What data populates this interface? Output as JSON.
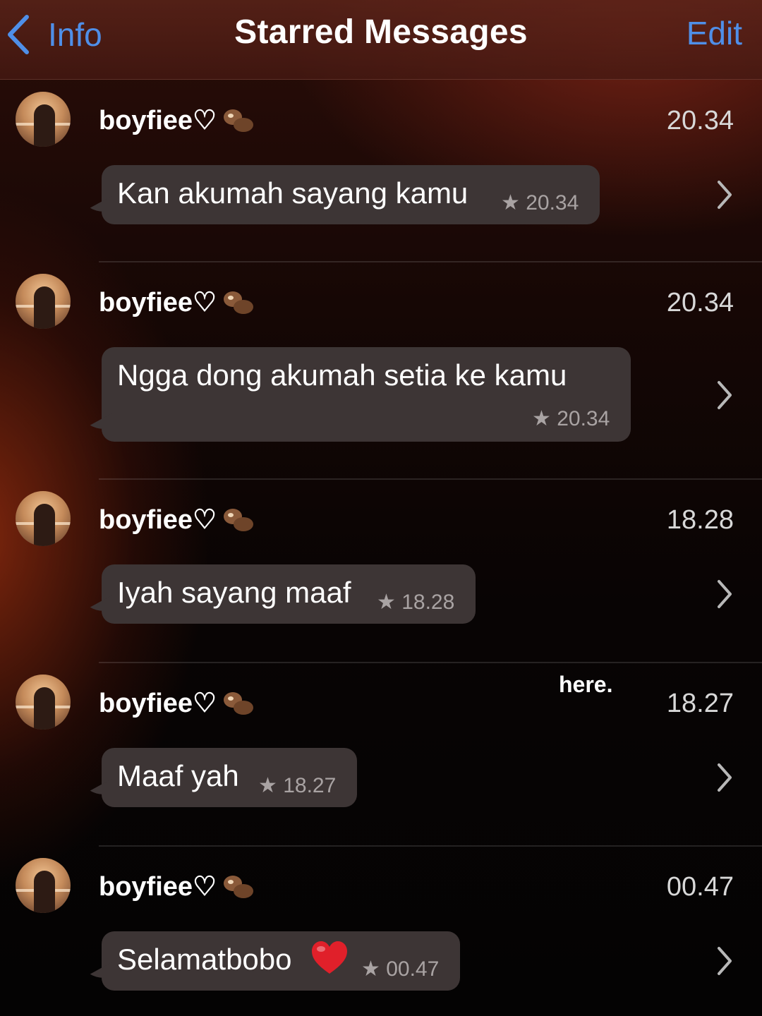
{
  "nav": {
    "back_label": "Info",
    "title": "Starred Messages",
    "edit_label": "Edit"
  },
  "overlay": {
    "text": "here."
  },
  "messages": [
    {
      "sender": "boyfiee♡",
      "time": "20.34",
      "text": "Kan akumah sayang kamu",
      "stamp": "★ 20.34"
    },
    {
      "sender": "boyfiee♡",
      "time": "20.34",
      "text": "Ngga dong akumah setia ke kamu",
      "stamp": "★ 20.34"
    },
    {
      "sender": "boyfiee♡",
      "time": "18.28",
      "text": "Iyah sayang maaf",
      "stamp": "★ 18.28"
    },
    {
      "sender": "boyfiee♡",
      "time": "18.27",
      "text": "Maaf yah",
      "stamp": "★ 18.27"
    },
    {
      "sender": "boyfiee♡",
      "time": "00.47",
      "text": "Selamatbobo",
      "stamp": "★ 00.47"
    }
  ],
  "icons": {
    "back": "chevron-left-icon",
    "sender_emoji": "otter-emoji-icon",
    "heart": "red-heart-emoji-icon",
    "row_disclosure": "chevron-right-icon"
  },
  "colors": {
    "accent": "#4f8fe8",
    "bubble": "#3d3535",
    "heart": "#e0202a"
  }
}
